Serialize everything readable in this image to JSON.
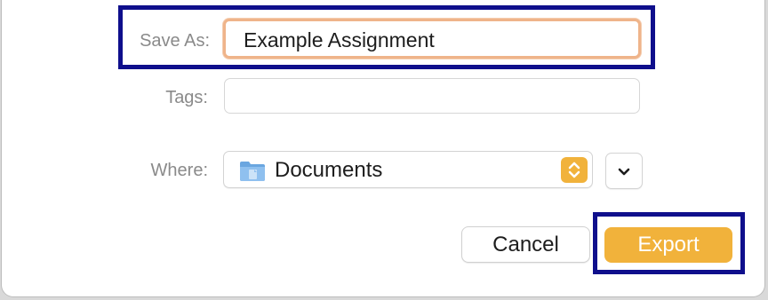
{
  "save_as": {
    "label": "Save As:",
    "value": "Example Assignment"
  },
  "tags": {
    "label": "Tags:",
    "value": ""
  },
  "where": {
    "label": "Where:",
    "location": "Documents",
    "folder_icon": "folder-icon",
    "stepper_icon": "up-down-chevron-icon",
    "expand_icon": "chevron-down-icon"
  },
  "buttons": {
    "cancel_label": "Cancel",
    "export_label": "Export"
  },
  "colors": {
    "accent": "#f1b23b",
    "focus_ring": "#efb48a",
    "annotation_box": "#0f0f8c"
  }
}
